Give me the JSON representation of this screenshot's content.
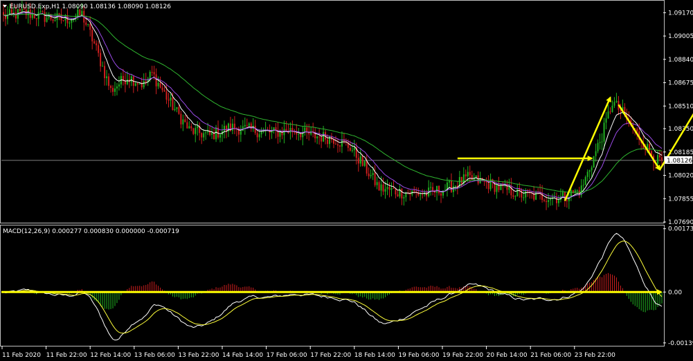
{
  "colors": {
    "background": "#000000",
    "bull": "#21b321",
    "bear": "#d01f1f",
    "ma_white": "#ffffff",
    "ma_purple": "#9b4be8",
    "ma_green": "#2fb52f",
    "annotation": "#ffff00",
    "macd_signal": "#ffff3a",
    "price_line": "#808080"
  },
  "chart_data": [
    {
      "type": "candlestick",
      "title": "EURUSD.Exp,H1  1.08090 1.08136 1.08090 1.08126",
      "symbol": "EURUSD.Exp,H1",
      "ohlc_last": [
        "1.08090",
        "1.08136",
        "1.08090",
        "1.08126"
      ],
      "ylim": [
        1.0769,
        1.0925
      ],
      "y_ticks": [
        "1.09170",
        "1.09005",
        "1.08840",
        "1.08675",
        "1.08510",
        "1.08350",
        "1.08185",
        "1.08020",
        "1.07855",
        "1.07690"
      ],
      "current_price_label": "1.08126",
      "current_price": 1.08126,
      "x_labels": [
        "11 Feb 2020",
        "11 Feb 22:00",
        "12 Feb 14:00",
        "13 Feb 06:00",
        "13 Feb 22:00",
        "14 Feb 14:00",
        "17 Feb 06:00",
        "17 Feb 22:00",
        "18 Feb 14:00",
        "19 Feb 06:00",
        "19 Feb 22:00",
        "20 Feb 14:00",
        "21 Feb 06:00",
        "23 Feb 22:00"
      ],
      "anchor_closes": [
        [
          0,
          1.0914
        ],
        [
          10,
          1.0917
        ],
        [
          20,
          1.0914
        ],
        [
          30,
          1.0912
        ],
        [
          38,
          1.0916
        ],
        [
          44,
          1.0895
        ],
        [
          52,
          1.0862
        ],
        [
          60,
          1.0872
        ],
        [
          68,
          1.0866
        ],
        [
          72,
          1.0874
        ],
        [
          80,
          1.0855
        ],
        [
          90,
          1.0834
        ],
        [
          100,
          1.083
        ],
        [
          110,
          1.0836
        ],
        [
          120,
          1.0834
        ],
        [
          130,
          1.0832
        ],
        [
          140,
          1.0834
        ],
        [
          150,
          1.083
        ],
        [
          160,
          1.0828
        ],
        [
          168,
          1.0822
        ],
        [
          174,
          1.081
        ],
        [
          182,
          1.0793
        ],
        [
          192,
          1.079
        ],
        [
          205,
          1.0789
        ],
        [
          215,
          1.0793
        ],
        [
          225,
          1.08
        ],
        [
          235,
          1.0796
        ],
        [
          245,
          1.0791
        ],
        [
          252,
          1.0788
        ],
        [
          262,
          1.0787
        ],
        [
          270,
          1.0786
        ],
        [
          280,
          1.0792
        ],
        [
          290,
          1.083
        ],
        [
          295,
          1.0854
        ],
        [
          300,
          1.0846
        ],
        [
          306,
          1.0833
        ],
        [
          312,
          1.0821
        ],
        [
          317,
          1.0812
        ]
      ],
      "moving_averages": [
        {
          "period": 8,
          "color": "#ffffff"
        },
        {
          "period": 16,
          "color": "#9b4be8"
        },
        {
          "period": 50,
          "color": "#2fb52f"
        }
      ],
      "annotations": [
        {
          "type": "horizontal_arrow",
          "from": [
            220,
            1.0814
          ],
          "to": [
            285,
            1.0814
          ]
        },
        {
          "type": "arrow",
          "from": [
            272,
            1.0784
          ],
          "to": [
            294,
            1.0857
          ]
        },
        {
          "type": "arrow",
          "from": [
            298,
            1.0852
          ],
          "to": [
            318,
            1.0806
          ]
        },
        {
          "type": "arrow",
          "from": [
            318,
            1.0806
          ],
          "to": [
            350,
            1.0883
          ]
        }
      ]
    },
    {
      "type": "macd",
      "title": "MACD(12,26,9) 0.000277 0.000830 0.000000 -0.000719",
      "params": "MACD(12,26,9)",
      "values_text": [
        "0.000277",
        "0.000830",
        "0.000000",
        "-0.000719"
      ],
      "ylim": [
        -0.00145,
        0.0018
      ],
      "y_ticks": [
        "0.00173",
        "0.00",
        "-0.00139"
      ],
      "zero_arrow": true
    }
  ]
}
